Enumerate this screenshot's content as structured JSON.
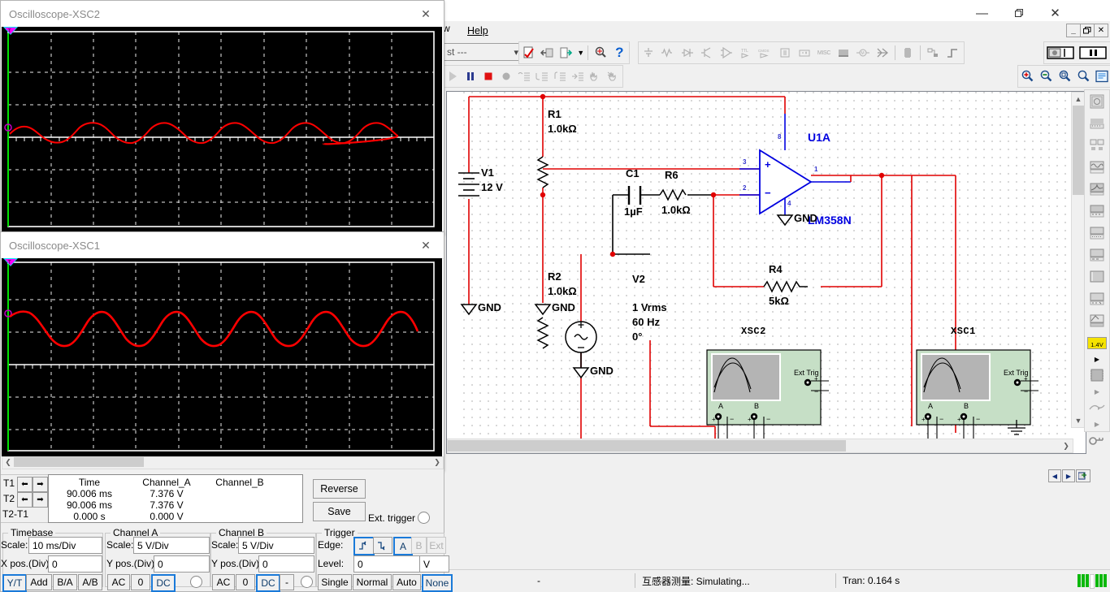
{
  "app": {
    "title": "",
    "menu": [
      "w",
      "Help"
    ],
    "window_controls": {
      "minimize": "—",
      "maximize": "❐",
      "close": "✕"
    },
    "mdi_controls": {
      "minimize": "_",
      "restore": "❐",
      "close": "✕"
    }
  },
  "toolbar": {
    "list_combo": "st ---",
    "chevron": "⌄",
    "help_icon": "?",
    "icons": [
      "checkmark-design-icon",
      "back-annotate-icon",
      "export-icon",
      "dropdown-caret-icon",
      "find-icon",
      "help-icon"
    ],
    "sim_icons": [
      "run-icon",
      "pause-icon",
      "stop-icon",
      "record-icon",
      "step-into-icon",
      "step-over-icon",
      "step-out-icon",
      "run-to-cursor-icon",
      "pause-hand-icon",
      "resume-hand-icon"
    ],
    "component_icons": [
      "source-icon",
      "basic-icon",
      "diode-icon",
      "transistor-icon",
      "analog-icon",
      "ttl-icon",
      "cmos-icon",
      "misc-digital-icon",
      "mixed-icon",
      "indicator-icon",
      "power-icon",
      "misc-icon",
      "advanced-peripheral-icon",
      "rf-icon",
      "electromechanical-icon",
      "ni-components-icon",
      "connector-icon",
      "mcu-icon",
      "hierarchical-block-icon",
      "bus-icon"
    ],
    "right_icons": [
      "in-use-list-icon",
      "pause-simulation-icon"
    ],
    "zoom_icons": [
      "zoom-in-icon",
      "zoom-out-icon",
      "zoom-area-icon",
      "zoom-fit-icon",
      "zoom-sheet-icon"
    ]
  },
  "instruments_toolbar": {
    "items": [
      "multimeter-icon",
      "function-generator-icon",
      "wattmeter-icon",
      "oscilloscope-icon",
      "four-channel-oscilloscope-icon",
      "bode-plotter-icon",
      "frequency-counter-icon",
      "word-generator-icon",
      "logic-converter-icon",
      "logic-analyzer-icon",
      "iv-analyzer-icon",
      "measurement-probe-icon",
      "probe-arrow-icon",
      "labview-instruments-icon",
      "labview-arrow-icon",
      "ni-elvis-icon",
      "ni-arrow-icon",
      "current-probe-icon"
    ],
    "probe_label": "1.4V"
  },
  "schematic": {
    "components": [
      {
        "ref": "R1",
        "value": "1.0kΩ"
      },
      {
        "ref": "R2",
        "value": "1.0kΩ"
      },
      {
        "ref": "R6",
        "value": "1.0kΩ"
      },
      {
        "ref": "R4",
        "value": "5kΩ"
      },
      {
        "ref": "C1",
        "value": "1µF"
      },
      {
        "ref": "V1",
        "value": "12 V"
      },
      {
        "ref": "V2",
        "value": "1 Vrms\n60 Hz\n0°"
      },
      {
        "ref": "U1A",
        "value": "LM358N"
      }
    ],
    "labels": {
      "r1": "R1",
      "r1v": "1.0kΩ",
      "r2": "R2",
      "r2v": "1.0kΩ",
      "r6": "R6",
      "r6v": "1.0kΩ",
      "r4": "R4",
      "r4v": "5kΩ",
      "c1": "C1",
      "c1v": "1µF",
      "v1": "V1",
      "v1v": "12 V",
      "v2": "V2",
      "v2a": "1 Vrms",
      "v2b": "60 Hz",
      "v2c": "0°",
      "u1a": "U1A",
      "part": "LM358N",
      "gnd": "GND",
      "xsc1": "XSC1",
      "xsc2": "XSC2",
      "ext_trig": "Ext Trig",
      "ch_a": "A",
      "ch_b": "B",
      "plus": "+",
      "minus": "−",
      "pin8": "8",
      "pin3": "3",
      "pin2": "2",
      "pin1": "1",
      "pin4": "4"
    },
    "colors": {
      "wire": "#e00000",
      "part": "#0000e0",
      "text": "#000000",
      "instrument_body": "#c6dfc6",
      "instrument_screen": "#b4b4b4"
    }
  },
  "statusbar": {
    "left": "-",
    "middle": "互感器测量: Simulating...",
    "right": "Tran: 0.164 s"
  },
  "scopes": [
    {
      "id": "xsc2",
      "title": "Oscilloscope-XSC2",
      "close_label": "✕",
      "waveform": {
        "color": "#ff0000",
        "amplitude_div": 0.21,
        "cycles": 4.6,
        "offset_div": 0.02
      }
    },
    {
      "id": "xsc1",
      "title": "Oscilloscope-XSC1",
      "close_label": "✕",
      "waveform": {
        "color": "#ff0000",
        "amplitude_div": 0.65,
        "cycles": 4.6,
        "offset_div": 0.0
      }
    }
  ],
  "scope_panel": {
    "cursors": {
      "t1_label": "T1",
      "t2_label": "T2",
      "diff_label": "T2-T1",
      "left_arrow": "⬅",
      "right_arrow": "➡"
    },
    "readout": {
      "headers": [
        "Time",
        "Channel_A",
        "Channel_B"
      ],
      "rows": [
        [
          "90.006 ms",
          "7.376 V",
          ""
        ],
        [
          "90.006 ms",
          "7.376 V",
          ""
        ],
        [
          "0.000 s",
          "0.000 V",
          ""
        ]
      ]
    },
    "buttons": {
      "reverse": "Reverse",
      "save": "Save"
    },
    "ext_trigger_label": "Ext. trigger",
    "timebase": {
      "group": "Timebase",
      "scale_label": "Scale:",
      "scale_value": "10 ms/Div",
      "xpos_label": "X pos.(Div):",
      "xpos_value": "0",
      "modes": [
        "Y/T",
        "Add",
        "B/A",
        "A/B"
      ],
      "selected_mode": "Y/T"
    },
    "channel_a": {
      "group": "Channel A",
      "scale_label": "Scale:",
      "scale_value": "5  V/Div",
      "ypos_label": "Y pos.(Div):",
      "ypos_value": "0",
      "coupling": [
        "AC",
        "0",
        "DC"
      ],
      "selected_coupling": "DC"
    },
    "channel_b": {
      "group": "Channel B",
      "scale_label": "Scale:",
      "scale_value": "5  V/Div",
      "ypos_label": "Y pos.(Div):",
      "ypos_value": "0",
      "coupling": [
        "AC",
        "0",
        "DC",
        "-"
      ],
      "selected_coupling": "DC"
    },
    "trigger": {
      "group": "Trigger",
      "edge_label": "Edge:",
      "edge_buttons": [
        "rising-edge-icon",
        "falling-edge-icon",
        "A",
        "B",
        "Ext"
      ],
      "selected_edge_source": "A",
      "level_label": "Level:",
      "level_value": "0",
      "level_unit": "V",
      "modes": [
        "Single",
        "Normal",
        "Auto",
        "None"
      ],
      "selected_mode": "None"
    }
  }
}
